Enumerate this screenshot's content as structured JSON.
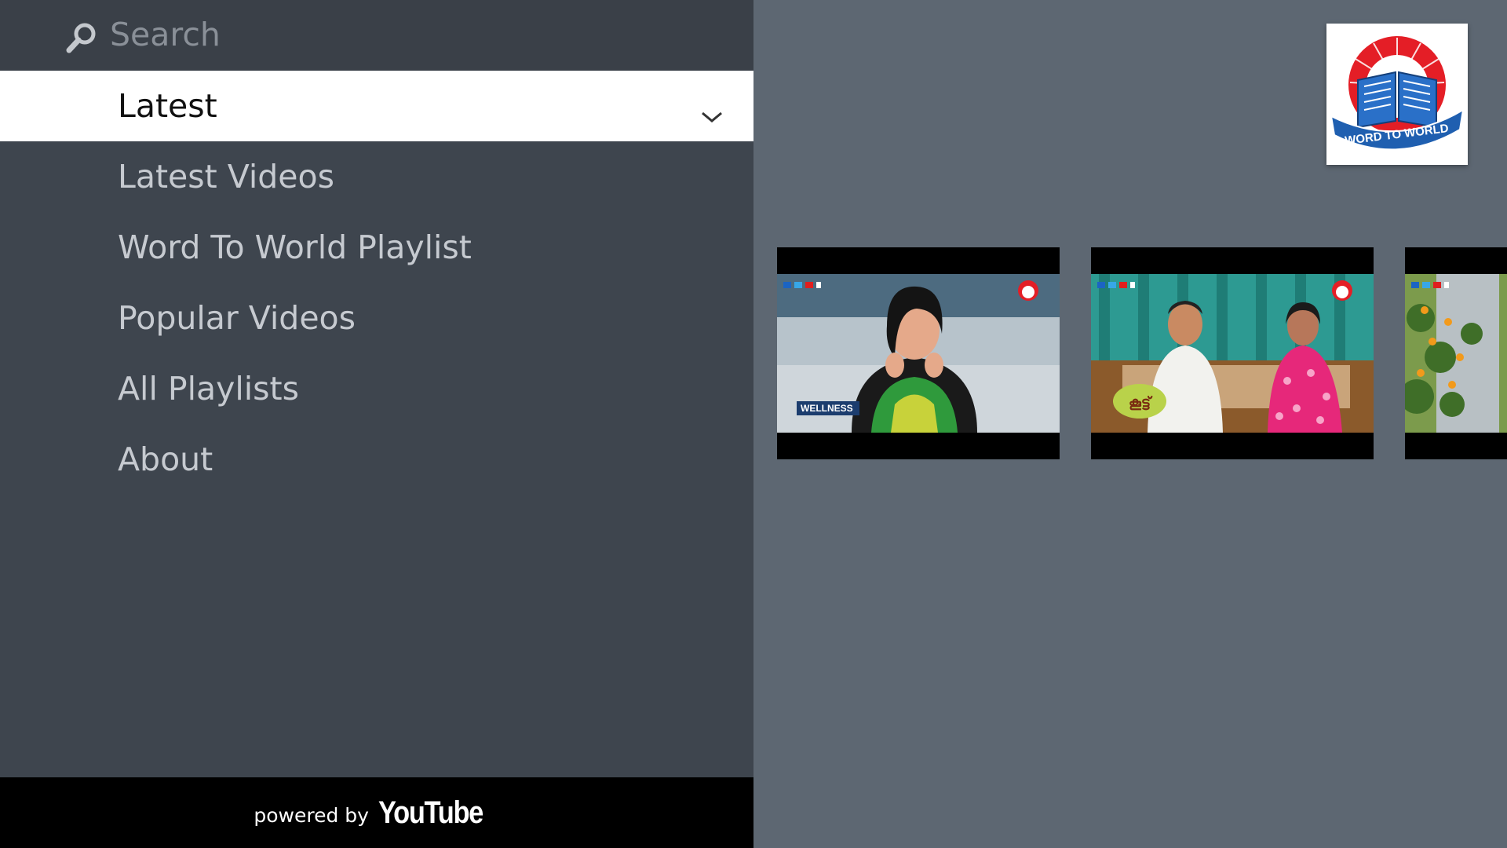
{
  "search": {
    "placeholder": "Search"
  },
  "menu": {
    "items": [
      {
        "label": "Latest",
        "selected": true
      },
      {
        "label": "Latest Videos",
        "selected": false
      },
      {
        "label": "Word To World Playlist",
        "selected": false
      },
      {
        "label": "Popular Videos",
        "selected": false
      },
      {
        "label": "All Playlists",
        "selected": false
      },
      {
        "label": "About",
        "selected": false
      }
    ]
  },
  "footer": {
    "powered_by": "powered by",
    "brand": "YouTube"
  },
  "channel": {
    "logo_text": "WORD TO WORLD"
  },
  "videos": [
    {
      "thumbnail_caption": "WELLNESS",
      "thumbnail_icon": "video-thumbnail-1"
    },
    {
      "thumbnail_caption": "കൂട്ട്",
      "thumbnail_icon": "video-thumbnail-2"
    },
    {
      "thumbnail_caption": "",
      "thumbnail_icon": "video-thumbnail-3"
    }
  ],
  "colors": {
    "nav_background": "#3e454e",
    "search_background": "#3a4048",
    "content_background": "#5d6772",
    "selected_background": "#ffffff",
    "footer_background": "#000000",
    "logo_red": "#e41e26",
    "logo_blue": "#1f5fb0"
  }
}
